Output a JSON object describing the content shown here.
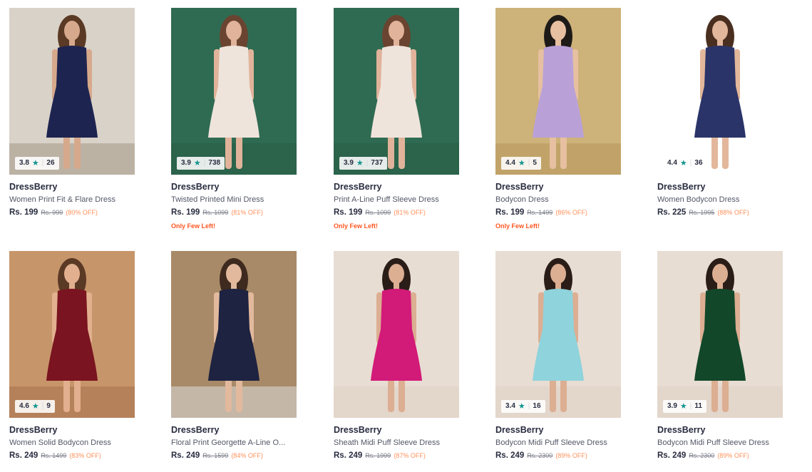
{
  "products": [
    {
      "brand": "DressBerry",
      "name": "Women Print Fit & Flare Dress",
      "price": "Rs. 199",
      "mrp": "Rs. 999",
      "discount": "(80% OFF)",
      "rating": "3.8",
      "rating_count": "26",
      "stock_note": "",
      "bg": "#d9d2c8",
      "floor": "#a89c8c",
      "dress": "#1e2450",
      "skin": "#d7a98c",
      "hair": "#5a3a25"
    },
    {
      "brand": "DressBerry",
      "name": "Twisted Printed Mini Dress",
      "price": "Rs. 199",
      "mrp": "Rs. 1099",
      "discount": "(81% OFF)",
      "rating": "3.9",
      "rating_count": "738",
      "stock_note": "Only Few Left!",
      "bg": "#2f6b52",
      "floor": "#2a5d48",
      "dress": "#efe4dc",
      "skin": "#e0b39a",
      "hair": "#6a4430"
    },
    {
      "brand": "DressBerry",
      "name": "Print A-Line Puff Sleeve Dress",
      "price": "Rs. 199",
      "mrp": "Rs. 1099",
      "discount": "(81% OFF)",
      "rating": "3.9",
      "rating_count": "737",
      "stock_note": "Only Few Left!",
      "bg": "#2f6b52",
      "floor": "#2a5d48",
      "dress": "#efe4dc",
      "skin": "#e0b39a",
      "hair": "#6a4430"
    },
    {
      "brand": "DressBerry",
      "name": "Bodycon Dress",
      "price": "Rs. 199",
      "mrp": "Rs. 1499",
      "discount": "(86% OFF)",
      "rating": "4.4",
      "rating_count": "5",
      "stock_note": "Only Few Left!",
      "bg": "#cdb27a",
      "floor": "#b99a5e",
      "dress": "#b9a1d8",
      "skin": "#e6c0a0",
      "hair": "#1e1a18"
    },
    {
      "brand": "DressBerry",
      "name": "Women Bodycon Dress",
      "price": "Rs. 225",
      "mrp": "Rs. 1995",
      "discount": "(88% OFF)",
      "rating": "4.4",
      "rating_count": "36",
      "stock_note": "",
      "bg": "#ffffff",
      "floor": "#ffffff",
      "dress": "#2b3468",
      "skin": "#e3b79b",
      "hair": "#4a2f20"
    },
    {
      "brand": "DressBerry",
      "name": "Women Solid Bodycon Dress",
      "price": "Rs. 249",
      "mrp": "Rs. 1499",
      "discount": "(83% OFF)",
      "rating": "4.6",
      "rating_count": "9",
      "stock_note": "",
      "bg": "#c7956a",
      "floor": "#a87550",
      "dress": "#7a1420",
      "skin": "#e2b08f",
      "hair": "#5b3a25"
    },
    {
      "brand": "DressBerry",
      "name": "Floral Print Georgette A-Line O...",
      "price": "Rs. 249",
      "mrp": "Rs. 1599",
      "discount": "(84% OFF)",
      "rating": "",
      "rating_count": "",
      "stock_note": "",
      "bg": "#a88a68",
      "floor": "#d7d6d2",
      "dress": "#1d2340",
      "skin": "#e2b99d",
      "hair": "#3e2a1e"
    },
    {
      "brand": "DressBerry",
      "name": "Sheath Midi Puff Sleeve Dress",
      "price": "Rs. 249",
      "mrp": "Rs. 1999",
      "discount": "(87% OFF)",
      "rating": "",
      "rating_count": "",
      "stock_note": "",
      "bg": "#e8ddd3",
      "floor": "#dfd2c6",
      "dress": "#d21a78",
      "skin": "#dcae92",
      "hair": "#2a1d18"
    },
    {
      "brand": "DressBerry",
      "name": "Bodycon Midi Puff Sleeve Dress",
      "price": "Rs. 249",
      "mrp": "Rs. 2300",
      "discount": "(89% OFF)",
      "rating": "3.4",
      "rating_count": "16",
      "stock_note": "",
      "bg": "#e8ddd3",
      "floor": "#dfd2c6",
      "dress": "#8fd3dc",
      "skin": "#dcae92",
      "hair": "#2a1d18"
    },
    {
      "brand": "DressBerry",
      "name": "Bodycon Midi Puff Sleeve Dress",
      "price": "Rs. 249",
      "mrp": "Rs. 2300",
      "discount": "(89% OFF)",
      "rating": "3.9",
      "rating_count": "11",
      "stock_note": "",
      "bg": "#e8ddd3",
      "floor": "#dfd2c6",
      "dress": "#12472a",
      "skin": "#dcae92",
      "hair": "#2a1d18"
    }
  ]
}
